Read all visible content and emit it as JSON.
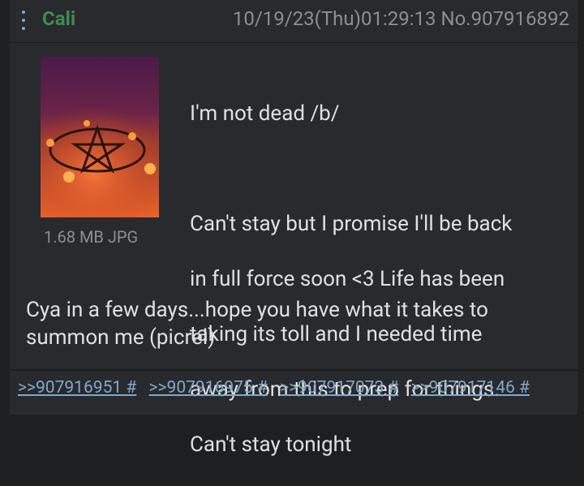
{
  "post": {
    "name": "Cali",
    "meta": "10/19/23(Thu)01:29:13 No.907916892",
    "file_info": "1.68 MB JPG",
    "body_lines": [
      "I'm not dead /b/",
      "",
      "Can't stay but I promise I'll be back",
      "in full force soon <3 Life has been",
      "taking its toll and I needed time",
      "away from this to prep for things.",
      "Can't stay tonight"
    ],
    "body_tail": "Cya in a few days...hope you have what it takes to summon me (picrel)"
  },
  "replies": [
    ">>907916951 #",
    ">>907916975 #",
    ">>907917073 #",
    ">>907917146 #"
  ],
  "colors": {
    "name": "#3e8e4e",
    "link": "#7fa8c9",
    "text": "#e0e0e0",
    "meta": "#8a8f94"
  },
  "icons": [
    "menu-dots-icon"
  ]
}
